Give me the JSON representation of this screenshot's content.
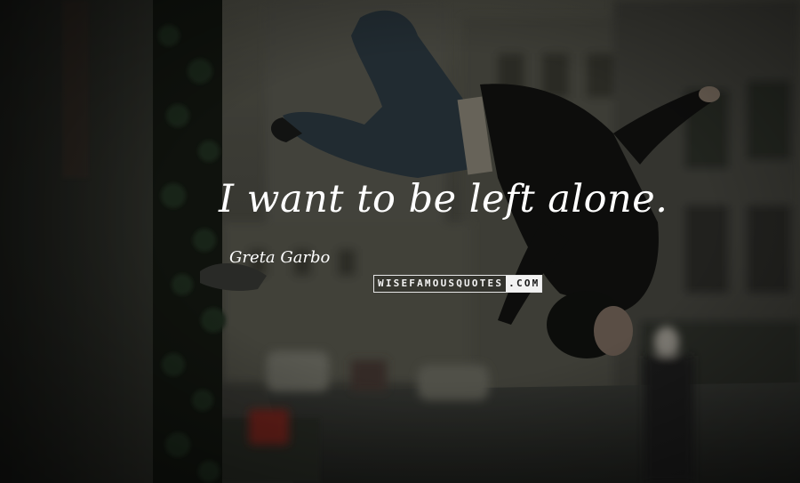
{
  "quote": {
    "text": "I want to be left alone.",
    "author": "Greta Garbo"
  },
  "watermark": {
    "main": "WISEFAMOUSQUOTES",
    "tld": ".COM"
  },
  "colors": {
    "text": "#ffffff",
    "photo_tint": "#1c1e1a",
    "wall": "#2b2d29",
    "street": "#4a4b45"
  }
}
